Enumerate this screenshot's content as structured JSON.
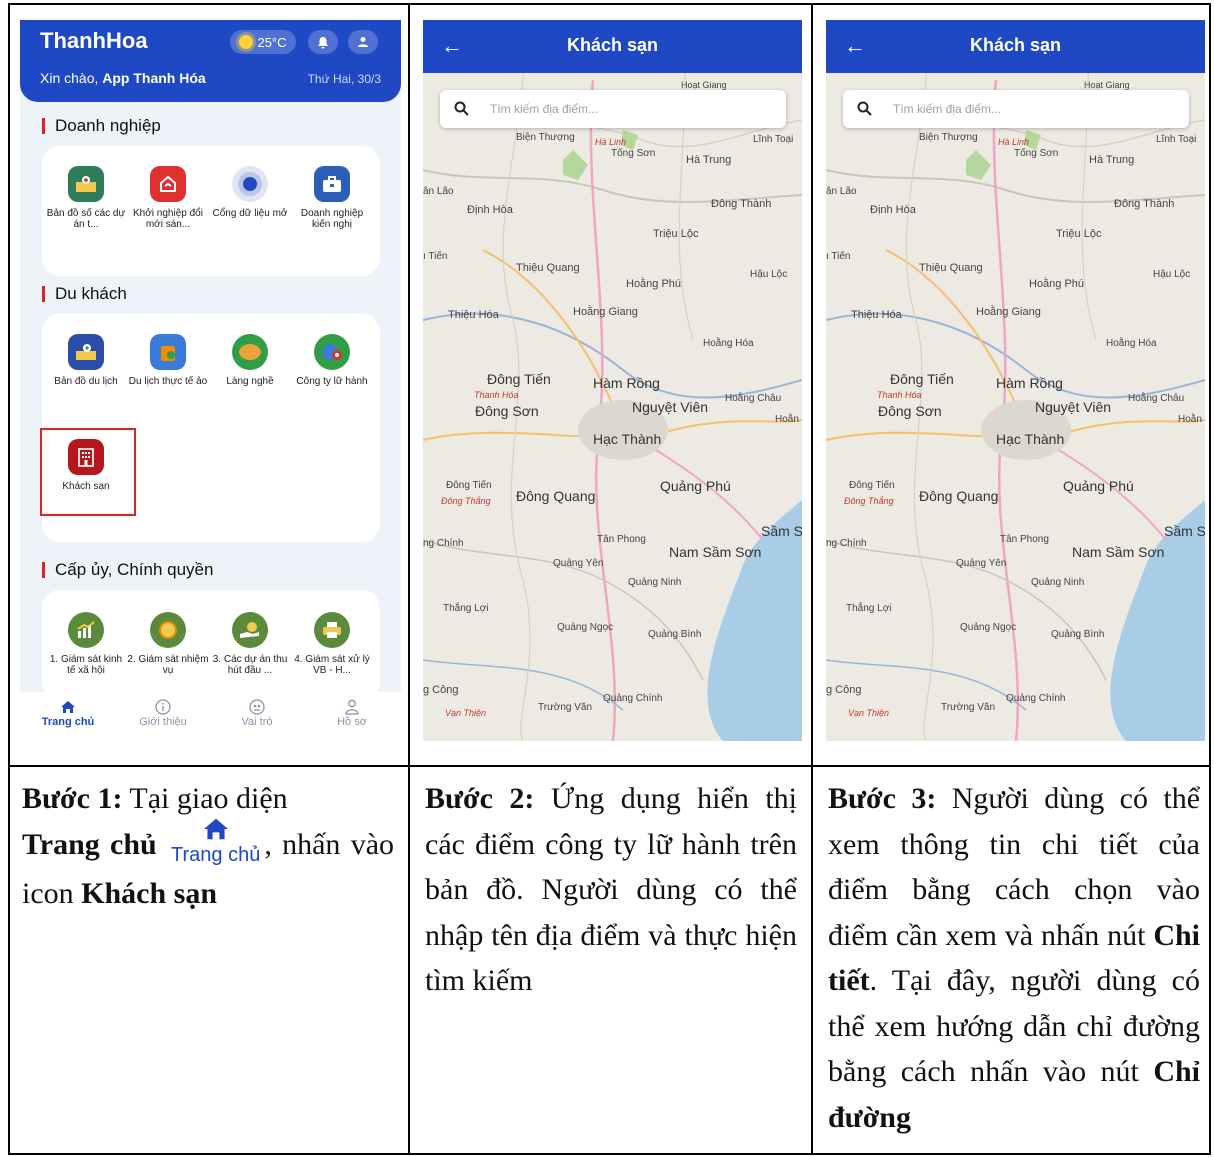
{
  "panel1": {
    "app_name": "ThanhHoa",
    "weather": "25°C",
    "greeting_prefix": "Xin chào, ",
    "greeting_name": "App Thanh Hóa",
    "date": "Thứ Hai, 30/3",
    "sections": [
      {
        "title": "Doanh nghiệp",
        "items": [
          "Bản đồ số các dự án t...",
          "Khởi nghiệp đổi mới sán...",
          "Cổng dữ liệu mở",
          "Doanh nghiệp kiến nghị"
        ]
      },
      {
        "title": "Du khách",
        "items": [
          "Bản đồ du lịch",
          "Du lịch thực tế ảo",
          "Làng nghề",
          "Công ty lữ hành",
          "Khách sạn"
        ]
      },
      {
        "title": "Cấp ủy, Chính quyền",
        "items": [
          "1. Giám sát kinh tế xã hội",
          "2. Giám sát nhiệm vụ",
          "3. Các dự án thu hút đầu ...",
          "4. Giám sát xử lý VB - H..."
        ]
      }
    ],
    "nav": [
      "Trang chủ",
      "Giới thiệu",
      "Vai trò",
      "Hồ sơ"
    ],
    "colors": {
      "primary": "#1f49c4",
      "highlight": "#e02424"
    }
  },
  "map_screen": {
    "title": "Khách sạn",
    "search_placeholder": "Tìm kiếm địa điểm...",
    "places": [
      "Hoạt Giang",
      "Biện Thượng",
      "Hà Linh",
      "Tống Sơn",
      "Hà Trung",
      "Lĩnh Toại",
      "ân Lão",
      "Định Hòa",
      "Đông Thành",
      "Triệu Lộc",
      "ı Tiến",
      "Thiệu Quang",
      "Hoằng Phú",
      "Hậu Lộc",
      "Thiệu Hóa",
      "Hoằng Giang",
      "Hoằng Hóa",
      "Đông Tiến",
      "Thanh Hóa",
      "Hàm Rồng",
      "Đông Sơn",
      "Nguyệt Viên",
      "Hoằng Châu",
      "Hoằn",
      "Hạc Thành",
      "Đông Tiến",
      "Đông Thắng",
      "Đông Quang",
      "Quảng Phú",
      "ng Chính",
      "Tân Phong",
      "Sầm S",
      "Nam Sầm Sơn",
      "Quảng Yên",
      "Quảng Ninh",
      "Thắng Lợi",
      "Quảng Ngọc",
      "Quảng Bình",
      "g Công",
      "Vạn Thiện",
      "Trường Văn",
      "Quảng Chính",
      "Sầm Sơn",
      "Nam Sầm Sơn"
    ]
  },
  "steps": [
    {
      "label": "Bước 1:",
      "parts": [
        "Tại giao diện",
        "Trang chủ",
        "Trang chủ",
        ", nhấn vào icon",
        "Khách sạn"
      ]
    },
    {
      "label": "Bước 2:",
      "text": "Ứng dụng hiển thị các điểm công ty lữ hành trên bản đồ. Người dùng có thể nhập tên địa điểm và thực hiện tìm kiếm"
    },
    {
      "label": "Bước 3:",
      "text_a": "Người dùng có thể xem thông tin chi tiết của điểm bằng cách chọn vào điểm cần xem và nhấn nút",
      "bold_a": "Chi tiết",
      "text_b": ". Tại đây, người dùng có thể xem hướng dẫn chỉ đường bằng cách nhấn vào nút",
      "bold_b": "Chỉ đường"
    }
  ]
}
